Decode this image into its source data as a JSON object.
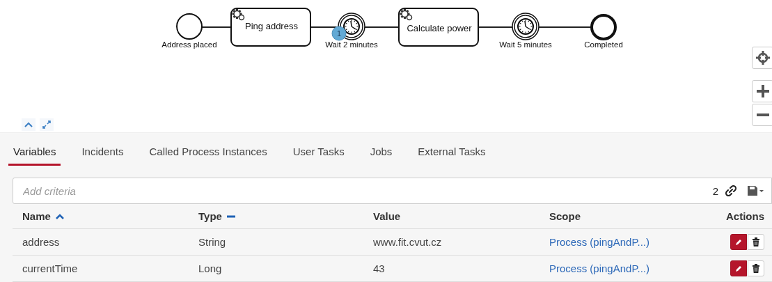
{
  "diagram": {
    "nodes": [
      {
        "kind": "start",
        "label": "Address placed"
      },
      {
        "kind": "task",
        "label": "Ping address"
      },
      {
        "kind": "timer",
        "label": "Wait 2 minutes",
        "badge": "1"
      },
      {
        "kind": "task",
        "label": "Calculate power"
      },
      {
        "kind": "timer",
        "label": "Wait 5 minutes"
      },
      {
        "kind": "end",
        "label": "Completed"
      }
    ]
  },
  "tabs": [
    {
      "label": "Variables",
      "selected": true
    },
    {
      "label": "Incidents",
      "selected": false
    },
    {
      "label": "Called Process Instances",
      "selected": false
    },
    {
      "label": "User Tasks",
      "selected": false
    },
    {
      "label": "Jobs",
      "selected": false
    },
    {
      "label": "External Tasks",
      "selected": false
    }
  ],
  "search": {
    "placeholder": "Add criteria",
    "count": "2"
  },
  "table": {
    "columns": [
      {
        "label": "Name",
        "sortable": true,
        "sorted": true
      },
      {
        "label": "Type",
        "sortable": true,
        "sorted": false
      },
      {
        "label": "Value"
      },
      {
        "label": "Scope"
      },
      {
        "label": "Actions"
      }
    ],
    "rows": [
      {
        "name": "address",
        "type": "String",
        "value": "www.fit.cvut.cz",
        "scope": "Process (pingAndP...)"
      },
      {
        "name": "currentTime",
        "type": "Long",
        "value": "43",
        "scope": "Process (pingAndP...)"
      }
    ]
  }
}
